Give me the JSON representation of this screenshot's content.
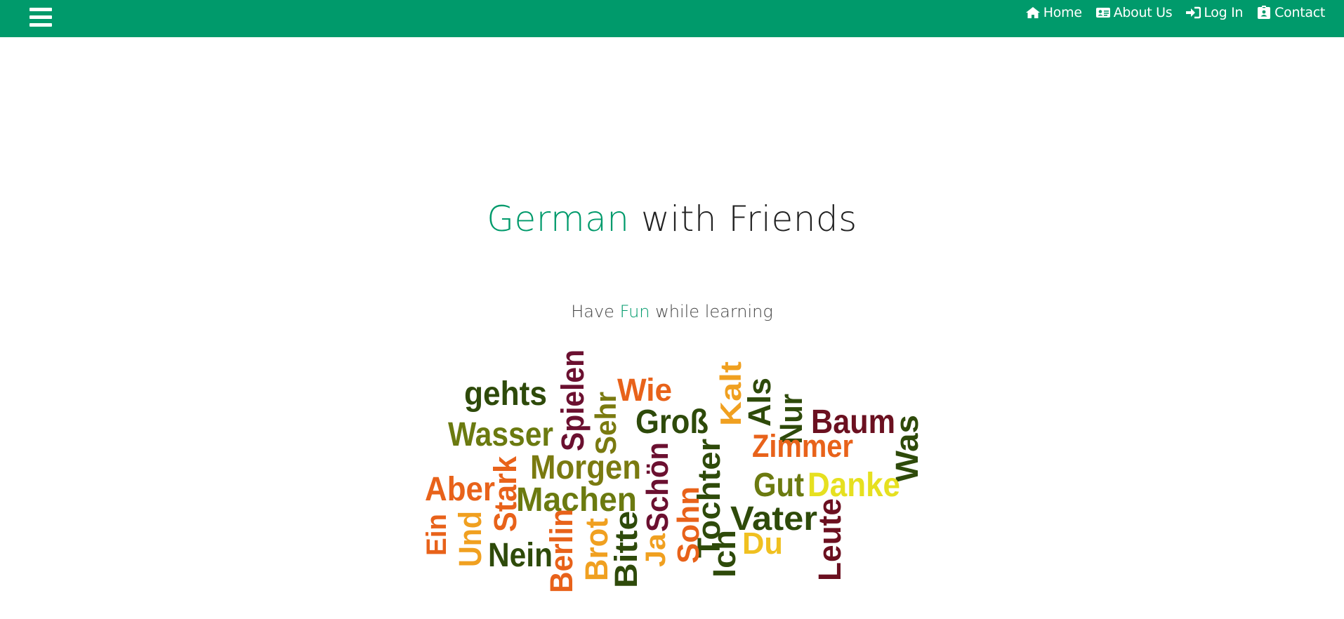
{
  "nav": {
    "menu_icon": "hamburger-menu-icon",
    "links": [
      {
        "label": "Home",
        "icon": "home-icon"
      },
      {
        "label": "About Us",
        "icon": "address-card-icon"
      },
      {
        "label": "Log In",
        "icon": "sign-in-icon"
      },
      {
        "label": "Contact",
        "icon": "id-badge-icon"
      }
    ]
  },
  "hero": {
    "title_accent": "German",
    "title_rest": " with Friends",
    "subtitle_before": "Have ",
    "subtitle_accent": "Fun",
    "subtitle_after": " while learning"
  },
  "colors": {
    "brand": "#009a6b",
    "text_dark": "#222222"
  },
  "word_cloud": {
    "words": [
      {
        "text": "gehts",
        "color": "#2e4a0a"
      },
      {
        "text": "Spielen",
        "color": "#6b1030"
      },
      {
        "text": "Wie",
        "color": "#e8621a"
      },
      {
        "text": "Kalt",
        "color": "#f0a020"
      },
      {
        "text": "Als",
        "color": "#2e4a0a"
      },
      {
        "text": "Nur",
        "color": "#2e4a0a"
      },
      {
        "text": "Baum",
        "color": "#6b1020"
      },
      {
        "text": "Was",
        "color": "#2e4a0a"
      },
      {
        "text": "Wasser",
        "color": "#6b7a10"
      },
      {
        "text": "Sehr",
        "color": "#7a7a10"
      },
      {
        "text": "Groß",
        "color": "#2e4a0a"
      },
      {
        "text": "Zimmer",
        "color": "#e8621a"
      },
      {
        "text": "Stark",
        "color": "#e8621a"
      },
      {
        "text": "Morgen",
        "color": "#7a7a10"
      },
      {
        "text": "Schön",
        "color": "#6b1030"
      },
      {
        "text": "Tochter",
        "color": "#2e4a0a"
      },
      {
        "text": "Aber",
        "color": "#e8621a"
      },
      {
        "text": "Machen",
        "color": "#6b7a10"
      },
      {
        "text": "Gut",
        "color": "#6b7a10"
      },
      {
        "text": "Danke",
        "color": "#e6e020"
      },
      {
        "text": "Ein",
        "color": "#e8621a"
      },
      {
        "text": "Und",
        "color": "#f0a020"
      },
      {
        "text": "Nein",
        "color": "#2e4a0a"
      },
      {
        "text": "Berlin",
        "color": "#e8621a"
      },
      {
        "text": "Brot",
        "color": "#f0a020"
      },
      {
        "text": "Bitte",
        "color": "#2e4a0a"
      },
      {
        "text": "Ja",
        "color": "#f0a020"
      },
      {
        "text": "Sohn",
        "color": "#e8621a"
      },
      {
        "text": "Ich",
        "color": "#2e4a0a"
      },
      {
        "text": "Vater",
        "color": "#2e4a0a"
      },
      {
        "text": "Du",
        "color": "#f0c020"
      },
      {
        "text": "Leute",
        "color": "#6b1020"
      }
    ]
  }
}
